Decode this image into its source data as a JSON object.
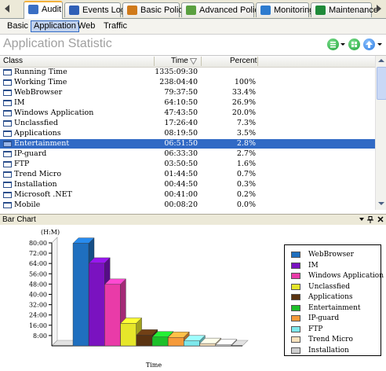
{
  "tabs": [
    {
      "label": "Audit",
      "icon": "audit-icon",
      "active": true,
      "icon_color": "#3a6fc4"
    },
    {
      "label": "Events Log",
      "icon": "events-log-icon",
      "active": false,
      "icon_color": "#2f5fb7"
    },
    {
      "label": "Basic Policy",
      "icon": "basic-policy-icon",
      "active": false,
      "icon_color": "#d07a1a"
    },
    {
      "label": "Advanced Policy",
      "icon": "advanced-policy-icon",
      "active": false,
      "icon_color": "#5aa040"
    },
    {
      "label": "Monitoring",
      "icon": "monitoring-icon",
      "active": false,
      "icon_color": "#2d7bcf"
    },
    {
      "label": "Maintenance",
      "icon": "maintenance-icon",
      "active": false,
      "icon_color": "#1f8a3a"
    }
  ],
  "subtabs": [
    {
      "label": "Basic",
      "active": false
    },
    {
      "label": "Application",
      "active": true
    },
    {
      "label": "Web",
      "active": false
    },
    {
      "label": "Traffic",
      "active": false
    }
  ],
  "title": "Application Statistic",
  "columns": {
    "class": "Class",
    "time": "Time",
    "percent": "Percent"
  },
  "rows": [
    {
      "name": "Running Time",
      "time": "1335:09:30",
      "percent": ""
    },
    {
      "name": "Working Time",
      "time": "238:04:40",
      "percent": "100%"
    },
    {
      "name": "WebBrowser",
      "time": "79:37:50",
      "percent": "33.4%"
    },
    {
      "name": "IM",
      "time": "64:10:50",
      "percent": "26.9%"
    },
    {
      "name": "Windows Application",
      "time": "47:43:50",
      "percent": "20.0%"
    },
    {
      "name": "Unclassfied",
      "time": "17:26:40",
      "percent": "7.3%"
    },
    {
      "name": "Applications",
      "time": "08:19:50",
      "percent": "3.5%"
    },
    {
      "name": "Entertainment",
      "time": "06:51:50",
      "percent": "2.8%",
      "selected": true
    },
    {
      "name": "IP-guard",
      "time": "06:33:30",
      "percent": "2.7%"
    },
    {
      "name": "FTP",
      "time": "03:50:50",
      "percent": "1.6%"
    },
    {
      "name": "Trend Micro",
      "time": "01:44:50",
      "percent": "0.7%"
    },
    {
      "name": "Installation",
      "time": "00:44:50",
      "percent": "0.3%"
    },
    {
      "name": "Microsoft .NET",
      "time": "00:41:00",
      "percent": "0.2%"
    },
    {
      "name": "Mobile",
      "time": "00:08:20",
      "percent": "0.0%"
    }
  ],
  "panel": {
    "title": "Bar Chart"
  },
  "colors": {
    "selection": "#316ac5",
    "title_gray": "#a0a0a0",
    "green_button": "#1fa33a",
    "blue_button": "#2a7be0"
  },
  "chart_data": {
    "type": "bar",
    "title": "",
    "ylabel": "(H:M)",
    "xlabel": "Time",
    "ylim": [
      0,
      80
    ],
    "yticks": [
      "8:00",
      "16:00",
      "24:00",
      "32:00",
      "40:00",
      "48:00",
      "56:00",
      "64:00",
      "72:00",
      "80:00"
    ],
    "legend_position": "right",
    "series": [
      {
        "name": "WebBrowser",
        "value": 79.63,
        "color": "#1f6fbf"
      },
      {
        "name": "IM",
        "value": 64.18,
        "color": "#7a12c0"
      },
      {
        "name": "Windows Application",
        "value": 47.73,
        "color": "#e93ba8"
      },
      {
        "name": "Unclassfied",
        "value": 17.44,
        "color": "#e6e62a"
      },
      {
        "name": "Applications",
        "value": 8.33,
        "color": "#5a3311"
      },
      {
        "name": "Entertainment",
        "value": 6.86,
        "color": "#1dbf2a"
      },
      {
        "name": "IP-guard",
        "value": 6.56,
        "color": "#f59a3a"
      },
      {
        "name": "FTP",
        "value": 3.85,
        "color": "#7ee8ec"
      },
      {
        "name": "Trend Micro",
        "value": 1.75,
        "color": "#f7e2bd"
      },
      {
        "name": "Installation",
        "value": 0.75,
        "color": "#cfcfcf"
      }
    ]
  }
}
